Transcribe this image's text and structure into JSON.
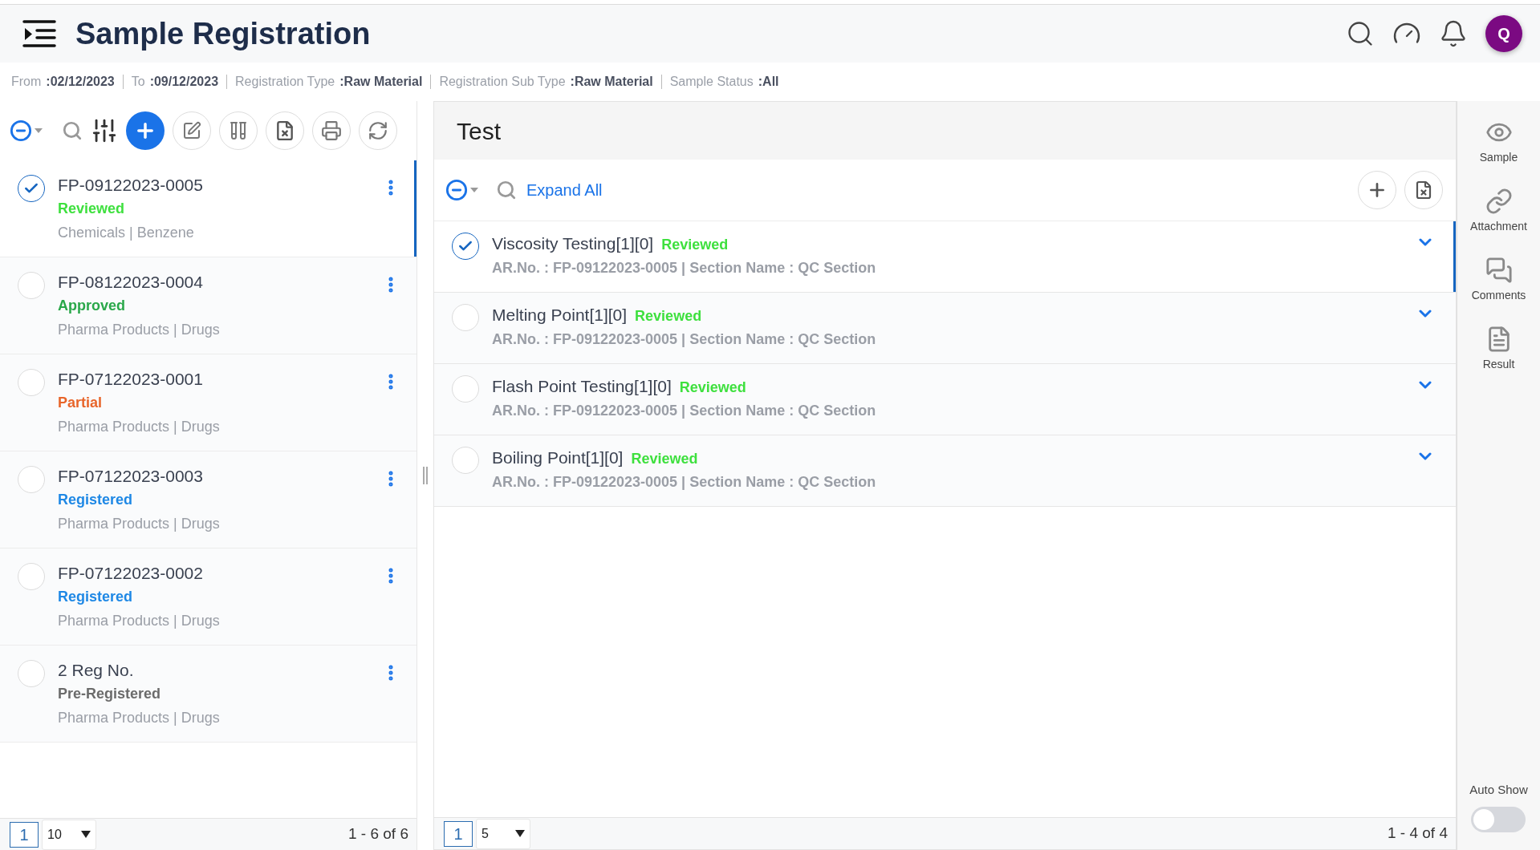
{
  "header": {
    "title": "Sample Registration",
    "avatar": "Q"
  },
  "filters": [
    {
      "label": "From",
      "value": ":02/12/2023"
    },
    {
      "label": "To",
      "value": ":09/12/2023"
    },
    {
      "label": "Registration Type",
      "value": ":Raw Material"
    },
    {
      "label": "Registration Sub Type",
      "value": ":Raw Material"
    },
    {
      "label": "Sample Status",
      "value": ":All"
    }
  ],
  "samples": [
    {
      "id": "FP-09122023-0005",
      "status": "Reviewed",
      "color": "#3ee03e",
      "category": "Chemicals | Benzene",
      "selected": true
    },
    {
      "id": "FP-08122023-0004",
      "status": "Approved",
      "color": "#2aa84a",
      "category": "Pharma Products | Drugs",
      "selected": false
    },
    {
      "id": "FP-07122023-0001",
      "status": "Partial",
      "color": "#e8652a",
      "category": "Pharma Products | Drugs",
      "selected": false
    },
    {
      "id": "FP-07122023-0003",
      "status": "Registered",
      "color": "#1e88e5",
      "category": "Pharma Products | Drugs",
      "selected": false
    },
    {
      "id": "FP-07122023-0002",
      "status": "Registered",
      "color": "#1e88e5",
      "category": "Pharma Products | Drugs",
      "selected": false
    },
    {
      "id": "2 Reg No.",
      "status": "Pre-Registered",
      "color": "#6b6b6b",
      "category": "Pharma Products | Drugs",
      "selected": false
    }
  ],
  "samples_pager": {
    "page": "1",
    "page_size": "10",
    "range": "1 - 6 of 6"
  },
  "test_panel": {
    "title": "Test",
    "expand_label": "Expand All",
    "tests": [
      {
        "name": "Viscosity Testing[1][0]",
        "status": "Reviewed",
        "color": "#3ee03e",
        "detail": "AR.No. : FP-09122023-0005 | Section Name : QC Section",
        "selected": true
      },
      {
        "name": "Melting Point[1][0]",
        "status": "Reviewed",
        "color": "#3ee03e",
        "detail": "AR.No. : FP-09122023-0005 | Section Name : QC Section",
        "selected": false
      },
      {
        "name": "Flash Point Testing[1][0]",
        "status": "Reviewed",
        "color": "#3ee03e",
        "detail": "AR.No. : FP-09122023-0005 | Section Name : QC Section",
        "selected": false
      },
      {
        "name": "Boiling Point[1][0]",
        "status": "Reviewed",
        "color": "#3ee03e",
        "detail": "AR.No. : FP-09122023-0005 | Section Name : QC Section",
        "selected": false
      }
    ],
    "pager": {
      "page": "1",
      "page_size": "5",
      "range": "1 - 4 of 4"
    }
  },
  "rail": [
    {
      "kind": "eye",
      "label": "Sample"
    },
    {
      "kind": "link",
      "label": "Attachment"
    },
    {
      "kind": "chat",
      "label": "Comments"
    },
    {
      "kind": "document",
      "label": "Result"
    }
  ],
  "auto_show": {
    "label": "Auto Show",
    "on": false
  }
}
